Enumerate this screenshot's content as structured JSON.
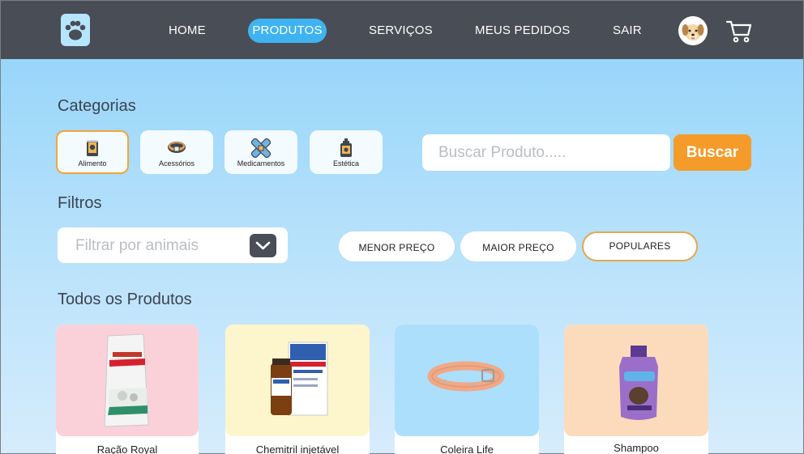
{
  "nav": {
    "logo_icon": "paw-icon",
    "links": [
      "HOME",
      "PRODUTOS",
      "SERVIÇOS",
      "MEUS PEDIDOS",
      "SAIR"
    ],
    "active": "PRODUTOS",
    "avatar_icon": "dog-avatar-icon",
    "cart_icon": "cart-icon"
  },
  "categories": {
    "title": "Categorias",
    "items": [
      {
        "label": "Alimento",
        "icon": "food-bag-icon",
        "active": true
      },
      {
        "label": "Acessórios",
        "icon": "collar-icon",
        "active": false
      },
      {
        "label": "Medicamentos",
        "icon": "bandage-icon",
        "active": false
      },
      {
        "label": "Estética",
        "icon": "shampoo-icon",
        "active": false
      }
    ]
  },
  "search": {
    "placeholder": "Buscar Produto.....",
    "button": "Buscar"
  },
  "filters": {
    "title": "Filtros",
    "animal_placeholder": "Filtrar por animais",
    "sort_options": [
      "MENOR PREÇO",
      "MAIOR PREÇO",
      "POPULARES"
    ],
    "active_sort": "POPULARES"
  },
  "products": {
    "title": "Todos os Produtos",
    "items": [
      {
        "name": "Ração Royal",
        "image": "royal-canin-bag"
      },
      {
        "name": "Chemitril injetável",
        "image": "chemitril-box"
      },
      {
        "name": "Coleira Life",
        "image": "orange-collar"
      },
      {
        "name": "Shampoo",
        "image": "shampoo-bottle"
      }
    ]
  },
  "colors": {
    "navbar": "#494d55",
    "accent_blue": "#3fb3f1",
    "accent_orange": "#f49b2a"
  }
}
